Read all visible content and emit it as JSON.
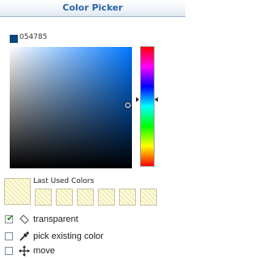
{
  "header": {
    "title": "Color Picker"
  },
  "current": {
    "hex": "054785",
    "color": "#054785"
  },
  "picker": {
    "hue_color": "#0077ff",
    "saturation": 0.97,
    "brightness": 0.52,
    "hue_fraction": 0.44
  },
  "last_used": {
    "label": "Last Used Colors",
    "swatches": [
      "empty",
      "empty",
      "empty",
      "empty",
      "empty",
      "empty"
    ]
  },
  "options": [
    {
      "label": "transparent",
      "checked": true,
      "icon": "eraser-icon"
    },
    {
      "label": "pick existing color",
      "checked": false,
      "icon": "eyedropper-icon"
    },
    {
      "label": "move",
      "checked": false,
      "icon": "move-arrows-icon"
    }
  ]
}
